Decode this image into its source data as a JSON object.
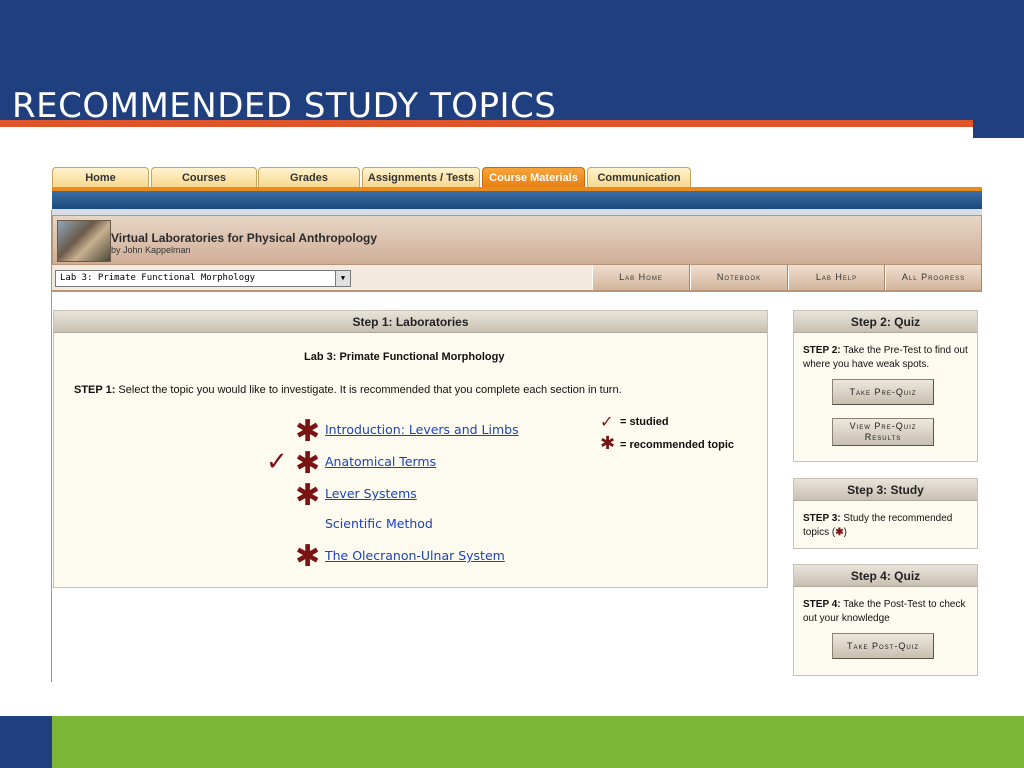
{
  "slide": {
    "title": "RECOMMENDED STUDY TOPICS"
  },
  "tabs": [
    {
      "label": "Home",
      "active": false
    },
    {
      "label": "Courses",
      "active": false
    },
    {
      "label": "Grades",
      "active": false
    },
    {
      "label": "Assignments / Tests",
      "active": false
    },
    {
      "label": "Course Materials",
      "active": true
    },
    {
      "label": "Communication",
      "active": false
    }
  ],
  "header": {
    "title": "Virtual Laboratories for Physical Anthropology",
    "author": "by John Kappelman"
  },
  "subnav": {
    "lab_select_value": "Lab 3: Primate Functional Morphology",
    "buttons": [
      "Lab Home",
      "Notebook",
      "Lab Help",
      "All Progress"
    ]
  },
  "step1": {
    "heading": "Step 1: Laboratories",
    "lab_title": "Lab 3: Primate Functional Morphology",
    "instruction_label": "STEP 1:",
    "instruction_text": " Select the topic you would like to investigate. It is recommended that you complete each section in turn.",
    "topics": [
      {
        "label": "Introduction: Levers and Limbs",
        "studied": false,
        "recommended": true
      },
      {
        "label": "Anatomical Terms",
        "studied": true,
        "recommended": true
      },
      {
        "label": "Lever Systems",
        "studied": false,
        "recommended": true
      },
      {
        "label": "Scientific Method",
        "studied": false,
        "recommended": false
      },
      {
        "label": "The Olecranon-Ulnar System",
        "studied": false,
        "recommended": true
      }
    ],
    "legend": {
      "studied": "= studied",
      "recommended": "= recommended topic"
    }
  },
  "step2": {
    "heading": "Step 2: Quiz",
    "label": "STEP 2:",
    "text": " Take the Pre-Test to find out where you have weak spots.",
    "button_pre_quiz": "Take Pre-Quiz",
    "button_results_line1": "View Pre-Quiz",
    "button_results_line2": "Results"
  },
  "step3": {
    "heading": "Step 3: Study",
    "label": "STEP 3:",
    "text": " Study the recommended topics (",
    "text_end": ")"
  },
  "step4": {
    "heading": "Step 4: Quiz",
    "label": "STEP 4:",
    "text": " Take the Post-Test to check out your knowledge",
    "button_post_quiz": "Take Post-Quiz"
  },
  "icons": {
    "star": "✱",
    "check": "✓"
  },
  "colors": {
    "slide_blue": "#1f3f7f",
    "slide_orange": "#e0562b",
    "slide_green": "#7cb637",
    "active_tab": "#e67e10",
    "link_blue": "#1a44b8",
    "icon_maroon": "#7a1414"
  }
}
